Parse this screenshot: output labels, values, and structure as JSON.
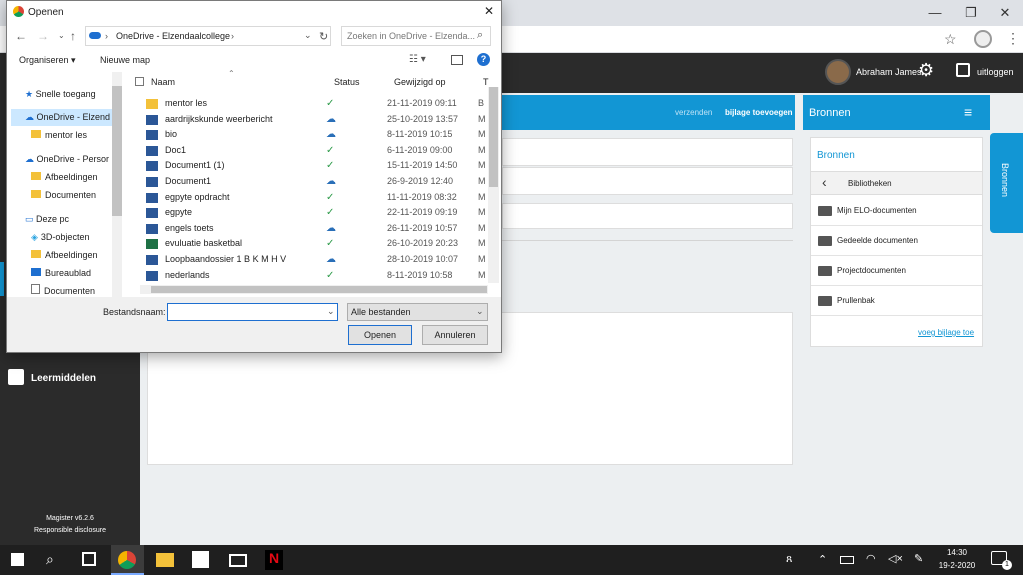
{
  "browser": {
    "minimize": "—",
    "restore": "❐",
    "close": "✕"
  },
  "app": {
    "user_name": "Abraham James",
    "logout_label": "uitloggen",
    "send_label": "verzenden",
    "attach_label": "bijlage toevoegen",
    "sources_header": "Bronnen",
    "sources_tab": "Bronnen",
    "sources_card_title": "Bronnen",
    "libraries_label": "Bibliotheken",
    "libraries": [
      "Mijn ELO-documenten",
      "Gedeelde documenten",
      "Projectdocumenten",
      "Prullenbak"
    ],
    "add_attachment_link": "voeg bijlage toe",
    "left_menu_item": "Leermiddelen",
    "version": "Magister v6.2.6",
    "disclosure": "Responsible disclosure"
  },
  "dialog": {
    "title": "Openen",
    "path_label": "OneDrive - Elzendaalcollege",
    "search_placeholder": "Zoeken in OneDrive - Elzenda...",
    "organize_label": "Organiseren ▾",
    "new_folder_label": "Nieuwe map",
    "columns": {
      "name": "Naam",
      "status": "Status",
      "modified": "Gewijzigd op",
      "type": "T"
    },
    "nav_items": [
      {
        "label": "Snelle toegang",
        "icon": "star-icon"
      },
      {
        "label": "OneDrive - Elzend",
        "icon": "cloud-icon"
      },
      {
        "label": "mentor les",
        "icon": "folder-icon"
      },
      {
        "label": "OneDrive - Persor",
        "icon": "cloud-icon"
      },
      {
        "label": "Afbeeldingen",
        "icon": "folder-icon"
      },
      {
        "label": "Documenten",
        "icon": "folder-icon"
      },
      {
        "label": "Deze pc",
        "icon": "computer-icon"
      },
      {
        "label": "3D-objecten",
        "icon": "cube-icon"
      },
      {
        "label": "Afbeeldingen",
        "icon": "folder-icon"
      },
      {
        "label": "Bureaublad",
        "icon": "desktop-icon"
      },
      {
        "label": "Documenten",
        "icon": "document-icon"
      }
    ],
    "files": [
      {
        "name": "mentor les",
        "status": "✓",
        "modified": "21-11-2019 09:11",
        "type": "B",
        "icon": "folder-icon",
        "status_kind": "synced"
      },
      {
        "name": "aardrijkskunde weerbericht",
        "status": "☁",
        "modified": "25-10-2019 13:57",
        "type": "M",
        "icon": "word-icon",
        "status_kind": "cloud"
      },
      {
        "name": "bio",
        "status": "☁",
        "modified": "8-11-2019 10:15",
        "type": "M",
        "icon": "word-icon",
        "status_kind": "cloud"
      },
      {
        "name": "Doc1",
        "status": "✓",
        "modified": "6-11-2019 09:00",
        "type": "M",
        "icon": "word-icon",
        "status_kind": "synced"
      },
      {
        "name": "Document1 (1)",
        "status": "✓",
        "modified": "15-11-2019 14:50",
        "type": "M",
        "icon": "word-icon",
        "status_kind": "synced"
      },
      {
        "name": "Document1",
        "status": "☁",
        "modified": "26-9-2019 12:40",
        "type": "M",
        "icon": "word-icon",
        "status_kind": "cloud"
      },
      {
        "name": "egpyte opdracht",
        "status": "✓",
        "modified": "11-11-2019 08:32",
        "type": "M",
        "icon": "word-icon",
        "status_kind": "synced"
      },
      {
        "name": "egpyte",
        "status": "✓",
        "modified": "22-11-2019 09:19",
        "type": "M",
        "icon": "word-icon",
        "status_kind": "synced"
      },
      {
        "name": "engels toets",
        "status": "☁",
        "modified": "26-11-2019 10:57",
        "type": "M",
        "icon": "word-icon",
        "status_kind": "cloud"
      },
      {
        "name": "evuluatie basketbal",
        "status": "✓",
        "modified": "26-10-2019 20:23",
        "type": "M",
        "icon": "excel-icon",
        "status_kind": "synced"
      },
      {
        "name": "Loopbaandossier 1 B K M H V",
        "status": "☁",
        "modified": "28-10-2019 10:07",
        "type": "M",
        "icon": "word-icon",
        "status_kind": "cloud"
      },
      {
        "name": "nederlands",
        "status": "✓",
        "modified": "8-11-2019 10:58",
        "type": "M",
        "icon": "word-icon",
        "status_kind": "synced"
      }
    ],
    "filename_label": "Bestandsnaam:",
    "filename_value": "",
    "filetype_value": "Alle bestanden",
    "open_button": "Openen",
    "cancel_button": "Annuleren"
  },
  "taskbar": {
    "time": "14:30",
    "date": "19-2-2020",
    "notification_count": "1"
  },
  "colors": {
    "accent": "#1296d4",
    "dark": "#2b2b2b",
    "synced": "#2e9b4a",
    "cloud": "#2a6fb8"
  }
}
